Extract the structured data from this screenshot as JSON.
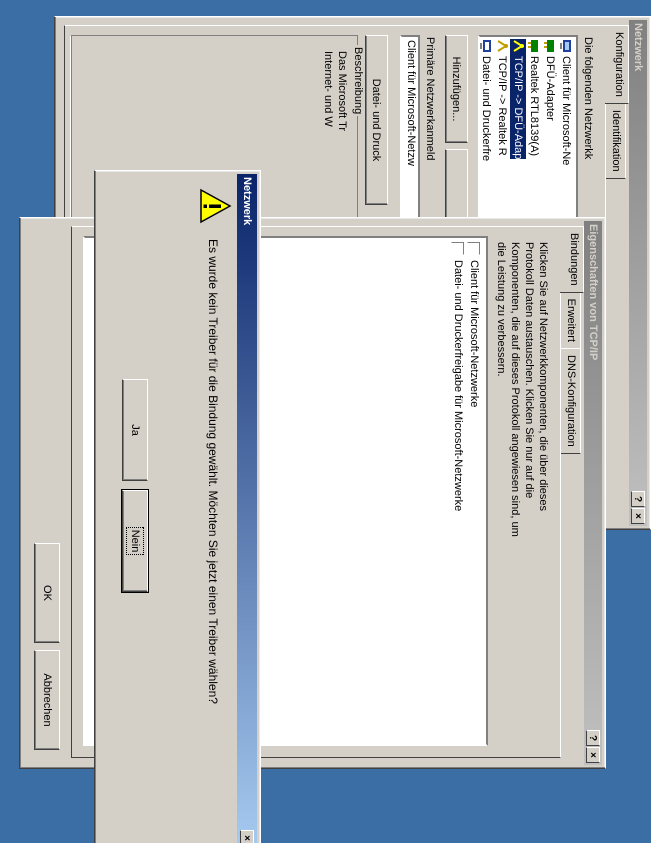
{
  "network_window": {
    "title": "Netzwerk",
    "help_label": "?",
    "close_label": "×",
    "tabs": [
      "Konfiguration",
      "Identifikation"
    ],
    "list_intro": "Die folgenden Netzwerkk",
    "components": [
      {
        "label": "Client für Microsoft-Ne",
        "icon": "client-icon"
      },
      {
        "label": "DFÜ-Adapter",
        "icon": "adapter-icon"
      },
      {
        "label": "Realtek RTL8139(A)",
        "icon": "adapter-icon"
      },
      {
        "label": "TCP/IP -> DFÜ-Adap",
        "icon": "protocol-icon",
        "selected": true
      },
      {
        "label": "TCP/IP -> Realtek R",
        "icon": "protocol-icon"
      },
      {
        "label": "Datei- und Druckerfre",
        "icon": "service-icon"
      }
    ],
    "add_button": "Hinzufügen...",
    "primary_logon_label": "Primäre Netzwerkanmeld",
    "primary_logon_value": "Client für Microsoft-Netzw",
    "file_print_button": "Datei- und Druck",
    "description_label": "Beschreibung",
    "description_text_1": "Das Microsoft Tr",
    "description_text_2": "Internet- und W"
  },
  "tcpip_window": {
    "title": "Eigenschaften von TCP/IP",
    "help_label": "?",
    "close_label": "×",
    "tabs": [
      "Bindungen",
      "Erweitert",
      "DNS-Konfiguration"
    ],
    "desc_1": "Klicken Sie auf Netzwerkkomponenten, die über dieses",
    "desc_2": "Protokoll Daten austauschen. Klicken Sie nur auf die",
    "desc_3": "Komponenten, die auf dieses Protokoll angewiesen sind, um",
    "desc_4": "die Leistung zu verbessern.",
    "bindings": [
      {
        "label": "Client für Microsoft-Netzwerke",
        "checked": false
      },
      {
        "label": "Datei- und Druckerfreigabe für Microsoft-Netzwerke",
        "checked": false
      }
    ],
    "ok_button": "OK",
    "cancel_button": "Abbrechen"
  },
  "dialog": {
    "title": "Netzwerk",
    "close_label": "×",
    "message": "Es wurde kein Treiber für die Bindung gewählt. Möchten Sie jetzt einen Treiber wählen?",
    "icon": "warning-icon",
    "yes_button": "Ja",
    "no_button": "Nein"
  },
  "colors": {
    "desktop": "#3a6ea5",
    "face": "#d4d0c8",
    "active_title": "#0a246a",
    "inactive_title": "#808080"
  }
}
